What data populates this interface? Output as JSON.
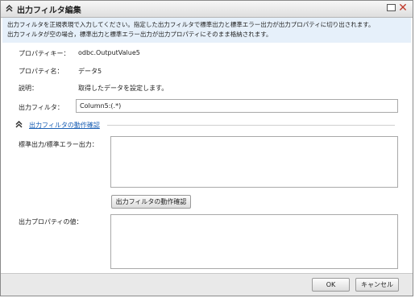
{
  "dialog": {
    "title": "出力フィルタ編集",
    "description_lines": [
      "出力フィルタを正規表現で入力してください。指定した出力フィルタで標準出力と標準エラー出力が出力プロパティに切り出されます。",
      "出力フィルタが空の場合，標準出力と標準エラー出力が出力プロパティにそのまま格納されます。"
    ]
  },
  "fields": {
    "property_key_label": "プロパティキー：",
    "property_key_value": "odbc.OutputValue5",
    "property_name_label": "プロパティ名：",
    "property_name_value": "データ5",
    "description_label": "説明：",
    "description_value": "取得したデータを設定します。",
    "output_filter_label": "出力フィルタ：",
    "output_filter_value": "Column5:(.*)"
  },
  "section": {
    "toggle_label": "出力フィルタの動作確認",
    "stdout_label": "標準出力/標準エラー出力：",
    "check_button": "出力フィルタの動作確認",
    "output_value_label": "出力プロパティの値："
  },
  "footer": {
    "ok": "OK",
    "cancel": "キャンセル"
  },
  "colors": {
    "accent": "#1a5fb4",
    "close": "#c0392b",
    "desc_bg": "#e6f0fa"
  }
}
